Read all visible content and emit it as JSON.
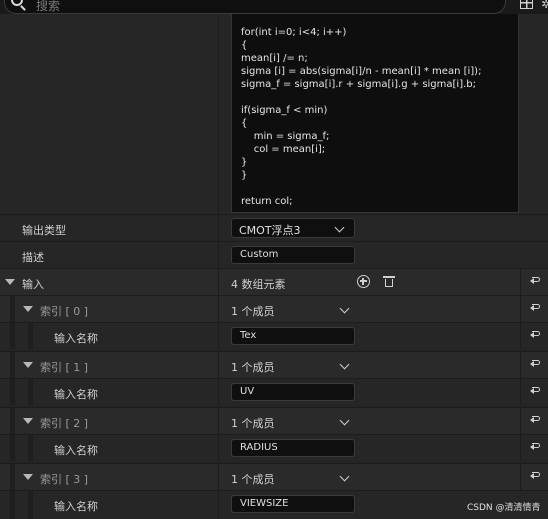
{
  "search": {
    "placeholder": "搜索"
  },
  "code_lines": [
    "for(int i=0; i<4; i++)",
    "{",
    "mean[i] /= n;",
    "sigma [i] = abs(sigma[i]/n - mean[i] * mean [i]);",
    "sigma_f = sigma[i].r + sigma[i].g + sigma[i].b;",
    "",
    "if(sigma_f < min)",
    "{",
    "    min = sigma_f;",
    "    col = mean[i];",
    "}",
    "}",
    "",
    "return col;"
  ],
  "output_type": {
    "label": "输出类型",
    "value": "CMOT浮点3"
  },
  "description": {
    "label": "描述",
    "value": "Custom"
  },
  "inputs": {
    "label": "输入",
    "count_text": "4 数组元素"
  },
  "input_items": [
    {
      "index_label": "索引 [ 0 ]",
      "members": "1 个成员",
      "name_label": "输入名称",
      "name_value": "Tex"
    },
    {
      "index_label": "索引 [ 1 ]",
      "members": "1 个成员",
      "name_label": "输入名称",
      "name_value": "UV"
    },
    {
      "index_label": "索引 [ 2 ]",
      "members": "1 个成员",
      "name_label": "输入名称",
      "name_value": "RADIUS"
    },
    {
      "index_label": "索引 [ 3 ]",
      "members": "1 个成员",
      "name_label": "输入名称",
      "name_value": "VIEWSIZE"
    }
  ],
  "watermark": "CSDN @清清情青"
}
